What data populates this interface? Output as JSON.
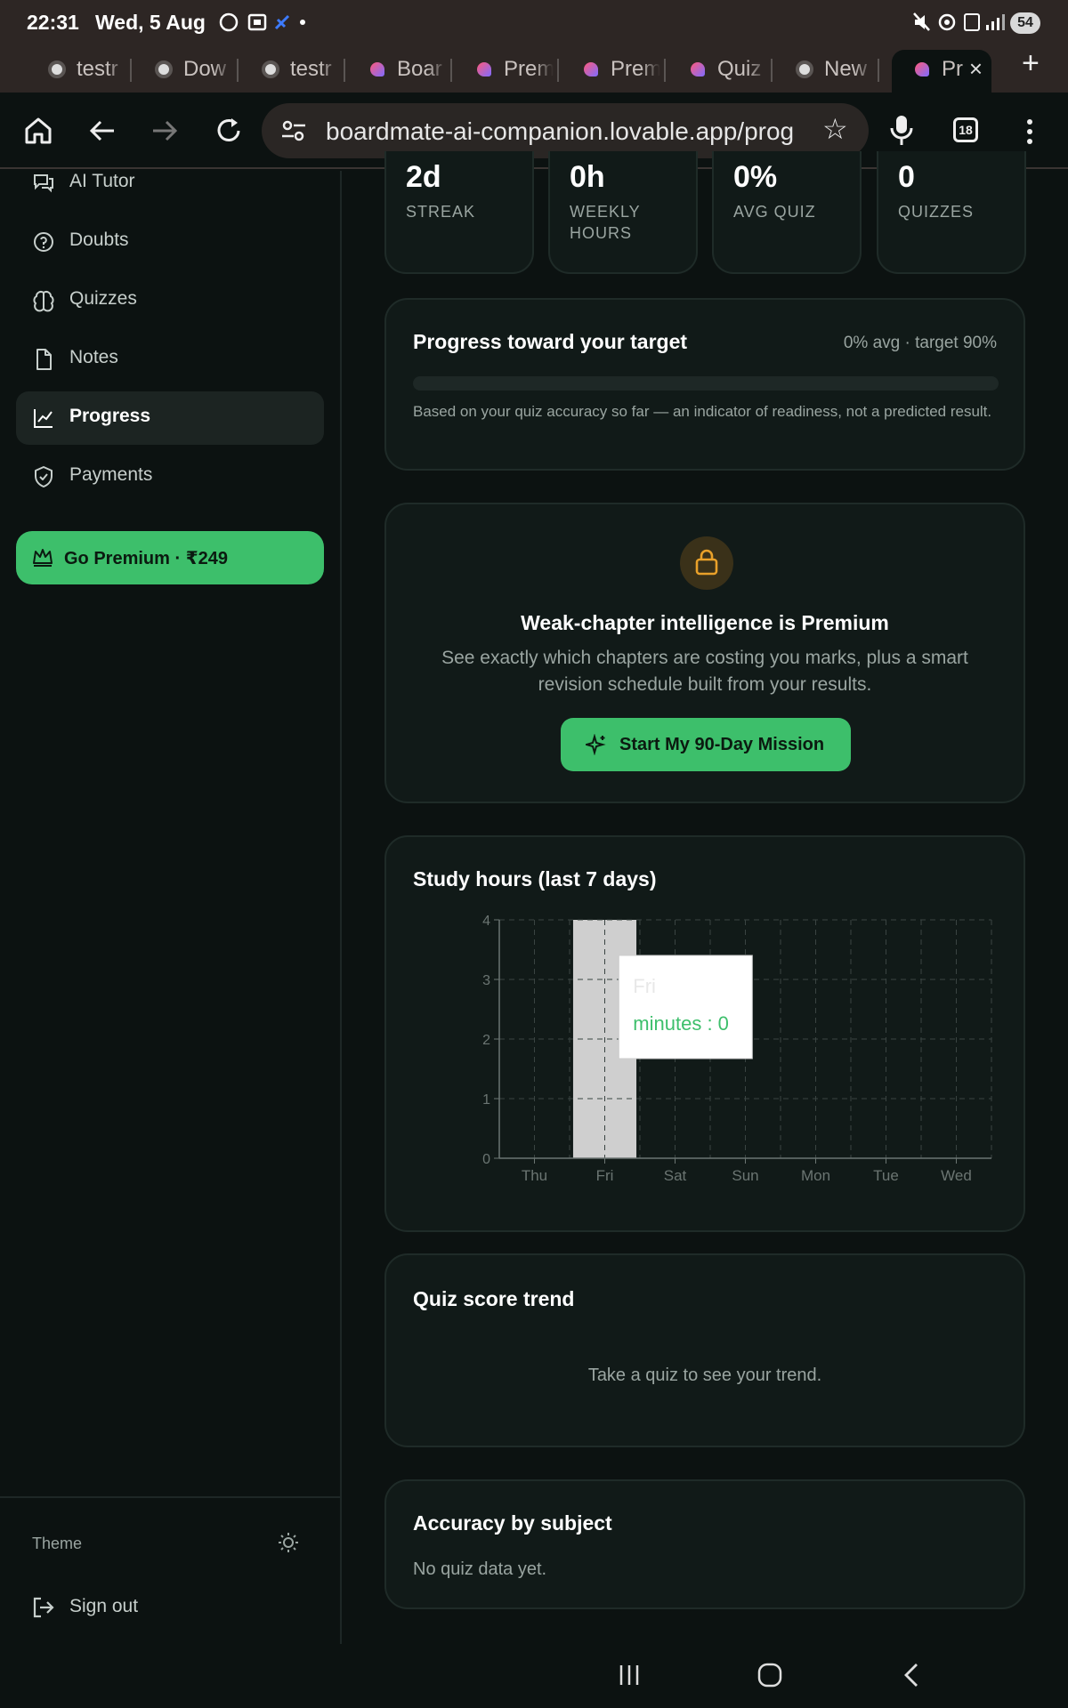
{
  "status_bar": {
    "time": "22:31",
    "date": "Wed, 5 Aug",
    "battery": "54",
    "icons": [
      "whatsapp-icon",
      "screenshot-icon",
      "app-icon",
      "dot-icon",
      "mute-icon",
      "hotspot-icon",
      "5g-icon",
      "signal-icon"
    ]
  },
  "tabs": [
    {
      "label": "testr",
      "favicon": "chrome"
    },
    {
      "label": "Dow",
      "favicon": "chrome"
    },
    {
      "label": "testr",
      "favicon": "chrome"
    },
    {
      "label": "Boar",
      "favicon": "lovable"
    },
    {
      "label": "Prem",
      "favicon": "lovable"
    },
    {
      "label": "Prem",
      "favicon": "lovable"
    },
    {
      "label": "Quiz",
      "favicon": "lovable"
    },
    {
      "label": "New",
      "favicon": "chrome"
    },
    {
      "label": "Pr",
      "favicon": "lovable",
      "active": true
    }
  ],
  "toolbar": {
    "url": "boardmate-ai-companion.lovable.app/prog",
    "tab_count": "18"
  },
  "sidebar": {
    "items": [
      {
        "label": "AI Tutor",
        "icon": "chat-icon"
      },
      {
        "label": "Doubts",
        "icon": "help-circle-icon"
      },
      {
        "label": "Quizzes",
        "icon": "brain-icon"
      },
      {
        "label": "Notes",
        "icon": "file-icon"
      },
      {
        "label": "Progress",
        "icon": "chart-line-icon",
        "active": true
      },
      {
        "label": "Payments",
        "icon": "shield-icon"
      }
    ],
    "premium_label": "Go Premium · ₹249",
    "theme_label": "Theme",
    "signout_label": "Sign out"
  },
  "stats": [
    {
      "value": "2d",
      "label": "STREAK"
    },
    {
      "value": "0h",
      "label": "WEEKLY HOURS"
    },
    {
      "value": "0%",
      "label": "AVG QUIZ"
    },
    {
      "value": "0",
      "label": "QUIZZES"
    }
  ],
  "target_card": {
    "title": "Progress toward your target",
    "meta": "0% avg · target 90%",
    "progress": 0,
    "note": "Based on your quiz accuracy so far — an indicator of readiness, not a predicted result."
  },
  "premium_card": {
    "title": "Weak-chapter intelligence is Premium",
    "desc": "See exactly which chapters are costing you marks, plus a smart revision schedule built from your results.",
    "button": "Start My 90-Day Mission"
  },
  "study_card": {
    "title": "Study hours (last 7 days)"
  },
  "chart_data": {
    "type": "bar",
    "categories": [
      "Thu",
      "Fri",
      "Sat",
      "Sun",
      "Mon",
      "Tue",
      "Wed"
    ],
    "values": [
      0,
      0,
      0,
      0,
      0,
      0,
      0
    ],
    "ylim": [
      0,
      4
    ],
    "yticks": [
      "0",
      "1",
      "2",
      "3",
      "4"
    ],
    "grid": true,
    "hover_category": "Fri",
    "tooltip": {
      "title": "Fri",
      "line": "minutes : 0"
    },
    "colors": {
      "tooltip_text": "#3dbf6b",
      "hover_band": "#cfcfcf"
    }
  },
  "quiz_card": {
    "title": "Quiz score trend",
    "empty": "Take a quiz to see your trend."
  },
  "accuracy_card": {
    "title": "Accuracy by subject",
    "empty": "No quiz data yet."
  },
  "colors": {
    "accent": "#3dbf6b",
    "background": "#0c1211",
    "card": "#111a18",
    "lock": "#e9a12a"
  }
}
